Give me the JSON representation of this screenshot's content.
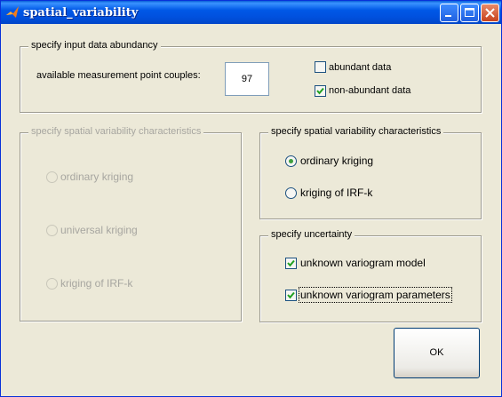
{
  "window": {
    "title": "spatial_variability",
    "controls": [
      "minimize",
      "maximize",
      "close"
    ]
  },
  "abundancy": {
    "group_title": "specify input data abundancy",
    "couples_label": "available measurement point couples:",
    "couples_value": "97",
    "abundant_label": "abundant data",
    "abundant_checked": false,
    "non_abundant_label": "non-abundant data",
    "non_abundant_checked": true
  },
  "spatial_disabled": {
    "group_title": "specify spatial variability characteristics",
    "options": [
      "ordinary kriging",
      "universal kriging",
      "kriging of IRF-k"
    ]
  },
  "spatial": {
    "group_title": "specify spatial variability characteristics",
    "options": [
      "ordinary kriging",
      "kriging of IRF-k"
    ],
    "selected": "ordinary kriging"
  },
  "uncertainty": {
    "group_title": "specify uncertainty",
    "model_label": "unknown variogram model",
    "model_checked": true,
    "parameters_label": "unknown variogram parameters",
    "parameters_checked": true
  },
  "ok_label": "OK",
  "colors": {
    "titlebar": "#0054e3",
    "dialog_bg": "#ece9d8",
    "check": "#21a121",
    "disabled_text": "#a7a6a0"
  }
}
